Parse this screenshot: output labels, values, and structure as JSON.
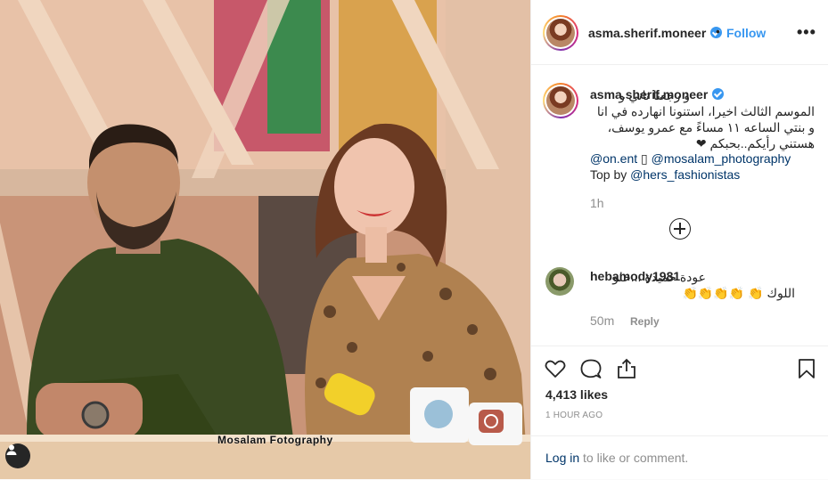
{
  "photo": {
    "watermark": "Mosalam Fotography",
    "user_tag_icon": "user-silhouette-icon"
  },
  "header": {
    "username": "asma.sherif.moneer",
    "separator": "•",
    "follow_label": "Follow",
    "more_icon": "more-options-icon",
    "more_label": "•••"
  },
  "caption": {
    "username": "asma.sherif.moneer",
    "text": "و رجعنا تاني و الموسم الثالث اخيرا، استنونا انهارده في انا و بنتي الساعه ١١ مساءً مع عمرو يوسف، هستني رأيكم..بحبكم ❤",
    "mention_on_ent": "@on.ent",
    "mention_separator": "▯",
    "mention_mosalam": "@mosalam_photography",
    "top_by_label": "Top by",
    "mention_hers": "@hers_fashionistas",
    "time": "1h",
    "load_more_icon": "plus-circle-icon"
  },
  "comments": [
    {
      "username": "hebamody1981",
      "text": "عودة حميدة ...حلو اللوك 👏 👏👏👏👏",
      "time": "50m",
      "reply_label": "Reply"
    }
  ],
  "actions": {
    "like_icon": "heart-icon",
    "comment_icon": "comment-bubble-icon",
    "share_icon": "share-upload-icon",
    "save_icon": "bookmark-icon",
    "likes": "4,413 likes",
    "time_ago": "1 HOUR AGO",
    "login_link": "Log in",
    "login_suffix": " to like or comment."
  }
}
